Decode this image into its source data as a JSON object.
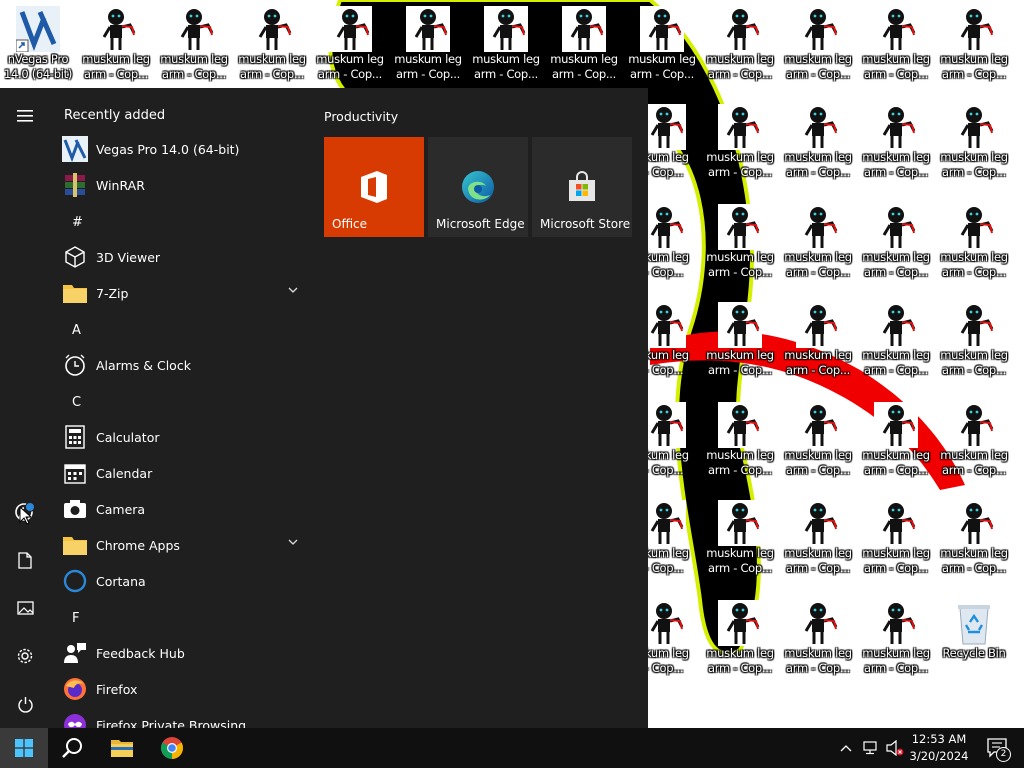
{
  "desktop": {
    "top_row_first_icon": {
      "label": "nVegas Pro\n14.0 (64-bit)",
      "icon": "vegas-pro-icon"
    },
    "shortcut_label": "muskum leg\narm - Cop...",
    "partial_label": "skum leg\n- Cop...",
    "shortcut_icon": "stick-figure-icon",
    "recycle_bin": {
      "label": "Recycle Bin",
      "icon": "recycle-bin-icon"
    }
  },
  "start_menu": {
    "recently_added_header": "Recently added",
    "recent_apps": [
      {
        "label": "Vegas Pro 14.0 (64-bit)",
        "icon": "vegas-pro-icon"
      },
      {
        "label": "WinRAR",
        "icon": "winrar-icon"
      }
    ],
    "groups": [
      {
        "letter": "#",
        "apps": [
          {
            "label": "3D Viewer",
            "icon": "cube-icon"
          },
          {
            "label": "7-Zip",
            "icon": "folder-icon",
            "expandable": true
          }
        ]
      },
      {
        "letter": "A",
        "apps": [
          {
            "label": "Alarms & Clock",
            "icon": "clock-icon"
          }
        ]
      },
      {
        "letter": "C",
        "apps": [
          {
            "label": "Calculator",
            "icon": "calculator-icon"
          },
          {
            "label": "Calendar",
            "icon": "calendar-icon"
          },
          {
            "label": "Camera",
            "icon": "camera-icon"
          },
          {
            "label": "Chrome Apps",
            "icon": "folder-icon",
            "expandable": true
          },
          {
            "label": "Cortana",
            "icon": "cortana-icon"
          }
        ]
      },
      {
        "letter": "F",
        "apps": [
          {
            "label": "Feedback Hub",
            "icon": "feedback-icon"
          },
          {
            "label": "Firefox",
            "icon": "firefox-icon"
          },
          {
            "label": "Firefox Private Browsing",
            "icon": "firefox-private-icon"
          }
        ]
      }
    ],
    "tiles_group_title": "Productivity",
    "tiles": [
      {
        "label": "Office",
        "icon": "office-icon",
        "color": "#d83b01"
      },
      {
        "label": "Microsoft Edge",
        "icon": "edge-icon",
        "color": "#2b2b2b"
      },
      {
        "label": "Microsoft Store",
        "icon": "store-icon",
        "color": "#2b2b2b"
      }
    ],
    "rail": [
      "hamburger-icon",
      "user-icon",
      "document-icon",
      "pictures-icon",
      "settings-icon",
      "power-icon"
    ]
  },
  "taskbar": {
    "pinned": [
      "windows-start-icon",
      "search-icon",
      "file-explorer-icon",
      "chrome-icon"
    ],
    "tray_icons": [
      "chevron-up-icon",
      "network-icon",
      "volume-muted-icon"
    ],
    "time": "12:53 AM",
    "date": "3/20/2024",
    "notification_count": "2"
  },
  "colors": {
    "accent_office": "#d83b01",
    "start_menu_bg": "#1f1f1f",
    "taskbar_bg": "#101010",
    "cortana_blue": "#2b88d8"
  }
}
